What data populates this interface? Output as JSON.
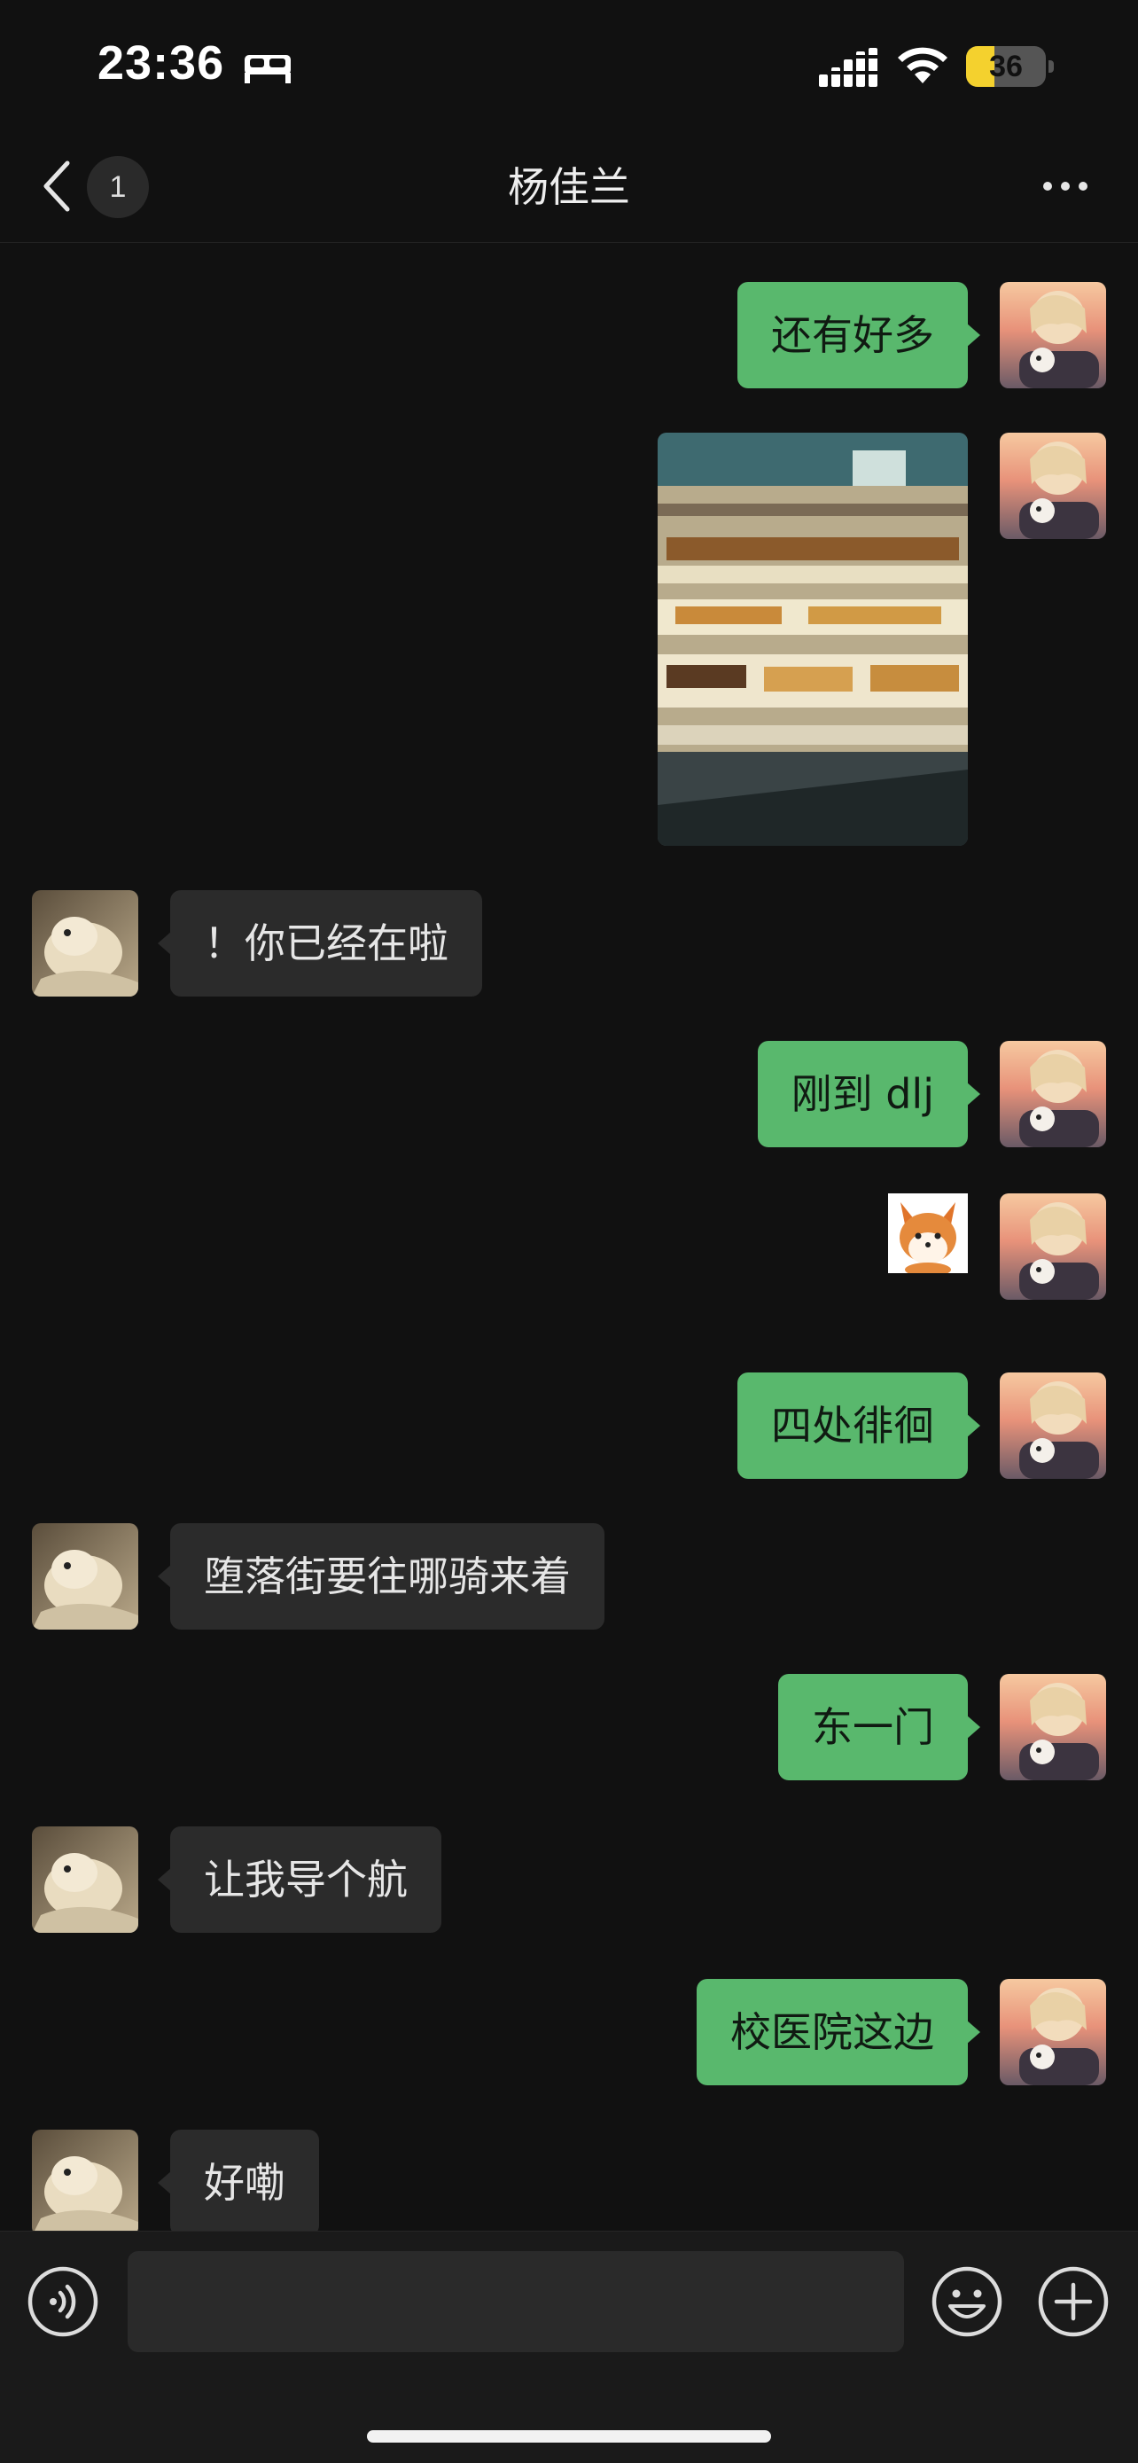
{
  "status_bar": {
    "time": "23:36",
    "battery_level": "36",
    "battery_fraction": 0.36,
    "icons": [
      "sleep-icon",
      "signal-icon",
      "wifi-icon",
      "battery-icon"
    ]
  },
  "nav": {
    "unread_count": "1",
    "title": "杨佳兰",
    "icons": [
      "back-chevron-icon",
      "more-dots-icon"
    ]
  },
  "colors": {
    "background": "#111111",
    "outgoing_bubble": "#59b86d",
    "incoming_bubble": "#2b2b2b",
    "battery_accent": "#f4d12e"
  },
  "messages": [
    {
      "direction": "out",
      "type": "text",
      "text": "还有好多"
    },
    {
      "direction": "out",
      "type": "image",
      "description_icon": "photo-bakery-display-case"
    },
    {
      "direction": "in",
      "type": "text",
      "text": "！你已经在啦"
    },
    {
      "direction": "out",
      "type": "text",
      "text": "刚到 dlj"
    },
    {
      "direction": "out",
      "type": "sticker",
      "description_icon": "fox-sticker"
    },
    {
      "direction": "out",
      "type": "text",
      "text": "四处徘徊"
    },
    {
      "direction": "in",
      "type": "text",
      "text": "堕落街要往哪骑来着"
    },
    {
      "direction": "out",
      "type": "text",
      "text": "东一门"
    },
    {
      "direction": "in",
      "type": "text",
      "text": "让我导个航"
    },
    {
      "direction": "out",
      "type": "text",
      "text": "校医院这边"
    },
    {
      "direction": "in",
      "type": "text",
      "text": "好嘞"
    }
  ],
  "input_bar": {
    "value": "",
    "placeholder": "",
    "icons": [
      "voice-icon",
      "emoji-icon",
      "plus-icon"
    ]
  }
}
